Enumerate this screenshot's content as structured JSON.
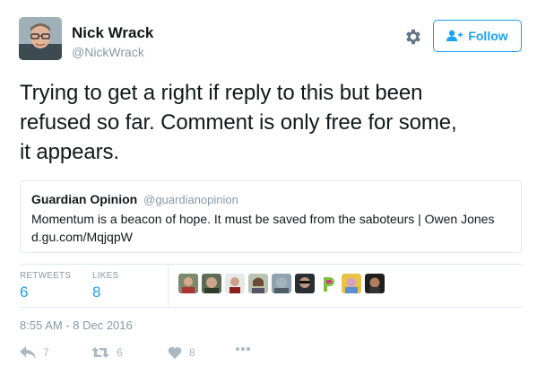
{
  "user": {
    "name": "Nick Wrack",
    "handle": "@NickWrack",
    "follow_label": "Follow"
  },
  "tweet": {
    "lines": [
      "Trying to get a right if reply to this but been",
      "refused so far. Comment is only free for some,",
      "it appears."
    ]
  },
  "quote": {
    "name": "Guardian Opinion",
    "handle": "@guardianopinion",
    "text": "Momentum is a beacon of hope. It must be saved from the saboteurs | Owen Jones",
    "link": "d.gu.com/MqjqpW"
  },
  "stats": {
    "retweets_label": "RETWEETS",
    "retweets_value": "6",
    "likes_label": "LIKES",
    "likes_value": "8"
  },
  "timestamp": "8:55 AM - 8 Dec 2016",
  "actions": {
    "reply_count": "7",
    "retweet_count": "6",
    "like_count": "8"
  },
  "colors": {
    "accent": "#1da1f2",
    "muted": "#8899a6",
    "action_gray": "#aab8c2"
  },
  "icons": {
    "settings": "gear-icon",
    "follow": "add-user-icon",
    "reply": "reply-icon",
    "retweet": "retweet-icon",
    "like": "heart-icon",
    "more": "more-icon"
  }
}
